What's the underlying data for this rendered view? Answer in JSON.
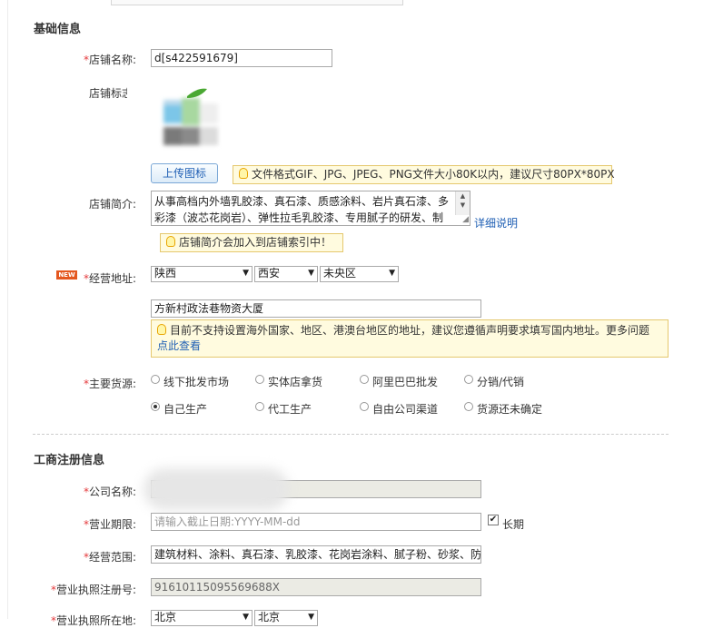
{
  "sections": {
    "basic": "基础信息",
    "business": "工商注册信息"
  },
  "shop_name": {
    "label": "店铺名称:",
    "value": "d[s422591679]"
  },
  "shop_logo": {
    "label": "店铺标志:",
    "upload_label": "上传图标",
    "tip": "文件格式GIF、JPG、JPEG、PNG文件大小80K以内，建议尺寸80PX*80PX"
  },
  "shop_intro": {
    "label": "店铺简介:",
    "line1": "从事高档内外墙乳胶漆、真石漆、质感涂料、岩片真石漆、多",
    "line2": "彩漆（波芯花岗岩）、弹性拉毛乳胶漆、专用腻子的研发、制",
    "detail_link": "详细说明",
    "tip": "店铺简介会加入到店铺索引中！"
  },
  "address": {
    "new_badge": "NEW",
    "label": "经营地址:",
    "province": "陕西",
    "city": "西安",
    "district": "未央区",
    "street": "方新村政法巷物资大厦",
    "tip": "目前不支持设置海外国家、地区、港澳台地区的地址，建议您遵循声明要求填写国内地址。更多问题",
    "tip_link": "点此查看"
  },
  "sources": {
    "label": "主要货源:",
    "options": [
      "线下批发市场",
      "实体店拿货",
      "阿里巴巴批发",
      "分销/代销",
      "自己生产",
      "代工生产",
      "自由公司渠道",
      "货源还未确定"
    ],
    "selected": "自己生产"
  },
  "company": {
    "label": "公司名称:"
  },
  "term": {
    "label": "营业期限:",
    "placeholder": "请输入截止日期:YYYY-MM-dd",
    "long_label": "长期",
    "long_checked": true
  },
  "scope": {
    "label": "经营范围:",
    "value": "建筑材料、涂料、真石漆、乳胶漆、花岗岩涂料、腻子粉、砂浆、防"
  },
  "license_no": {
    "label": "营业执照注册号:",
    "value": "91610115095569688X"
  },
  "license_loc": {
    "label": "营业执照所在地:",
    "province": "北京",
    "city": "北京"
  }
}
